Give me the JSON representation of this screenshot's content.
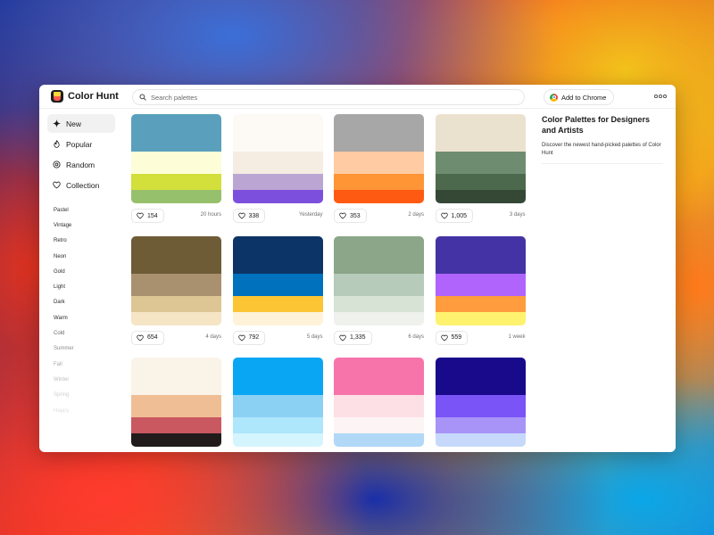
{
  "app": {
    "name": "Color Hunt"
  },
  "search": {
    "placeholder": "Search palettes"
  },
  "header": {
    "chrome_label": "Add to Chrome"
  },
  "nav": [
    {
      "label": "New",
      "icon": "sparkle-icon",
      "active": true
    },
    {
      "label": "Popular",
      "icon": "flame-icon",
      "active": false
    },
    {
      "label": "Random",
      "icon": "random-icon",
      "active": false
    },
    {
      "label": "Collection",
      "icon": "heart-icon",
      "active": false
    }
  ],
  "tags": [
    "Pastel",
    "Vintage",
    "Retro",
    "Neon",
    "Gold",
    "Light",
    "Dark",
    "Warm",
    "Cold",
    "Summer",
    "Fall",
    "Winter",
    "Spring",
    "Happy"
  ],
  "tag_colors": [
    "#2b2b2b",
    "#2b2b2b",
    "#2b2b2b",
    "#2b2b2b",
    "#2b2b2b",
    "#2b2b2b",
    "#2b2b2b",
    "#2b2b2b",
    "#6a6a6a",
    "#8c8c8c",
    "#a8a8a8",
    "#bdbdbd",
    "#cfcfcf",
    "#e0e0e0"
  ],
  "palettes": [
    {
      "colors": [
        "#5aa0bd",
        "#fdfed8",
        "#d3df3a",
        "#97c06c"
      ],
      "likes": "154",
      "date": "20 hours"
    },
    {
      "colors": [
        "#fdfaf5",
        "#f5ece2",
        "#bba6d3",
        "#7c4fdc"
      ],
      "likes": "338",
      "date": "Yesterday"
    },
    {
      "colors": [
        "#a7a7a7",
        "#ffcba2",
        "#ff9534",
        "#ff5a12"
      ],
      "likes": "353",
      "date": "2 days"
    },
    {
      "colors": [
        "#ebe1cf",
        "#6e8d70",
        "#4d694d",
        "#354836"
      ],
      "likes": "1,005",
      "date": "3 days"
    },
    {
      "colors": [
        "#6e5c37",
        "#a99170",
        "#ddc693",
        "#f5e5c5"
      ],
      "likes": "654",
      "date": "4 days"
    },
    {
      "colors": [
        "#0d3466",
        "#0072bd",
        "#fcc533",
        "#fef3d8"
      ],
      "likes": "792",
      "date": "5 days"
    },
    {
      "colors": [
        "#8ba688",
        "#b7cbba",
        "#d7e3d5",
        "#eef1ec"
      ],
      "likes": "1,335",
      "date": "6 days"
    },
    {
      "colors": [
        "#4433a4",
        "#b164fc",
        "#ff9c3d",
        "#fff26e"
      ],
      "likes": "559",
      "date": "1 week"
    },
    {
      "colors": [
        "#faf3e8",
        "#f0be94",
        "#c95861",
        "#211b1b"
      ],
      "likes": "",
      "date": ""
    },
    {
      "colors": [
        "#09a6f4",
        "#8bd1f4",
        "#aee6fb",
        "#d4f5fd"
      ],
      "likes": "",
      "date": ""
    },
    {
      "colors": [
        "#f774ab",
        "#fde0e5",
        "#fdf5f5",
        "#b1d8f7"
      ],
      "likes": "",
      "date": ""
    },
    {
      "colors": [
        "#180a8a",
        "#7a54f6",
        "#a894f7",
        "#c6d9fb"
      ],
      "likes": "",
      "date": ""
    }
  ],
  "panel": {
    "title": "Color Palettes for Designers and Artists",
    "description": "Discover the newest hand-picked palettes of Color Hunt"
  }
}
